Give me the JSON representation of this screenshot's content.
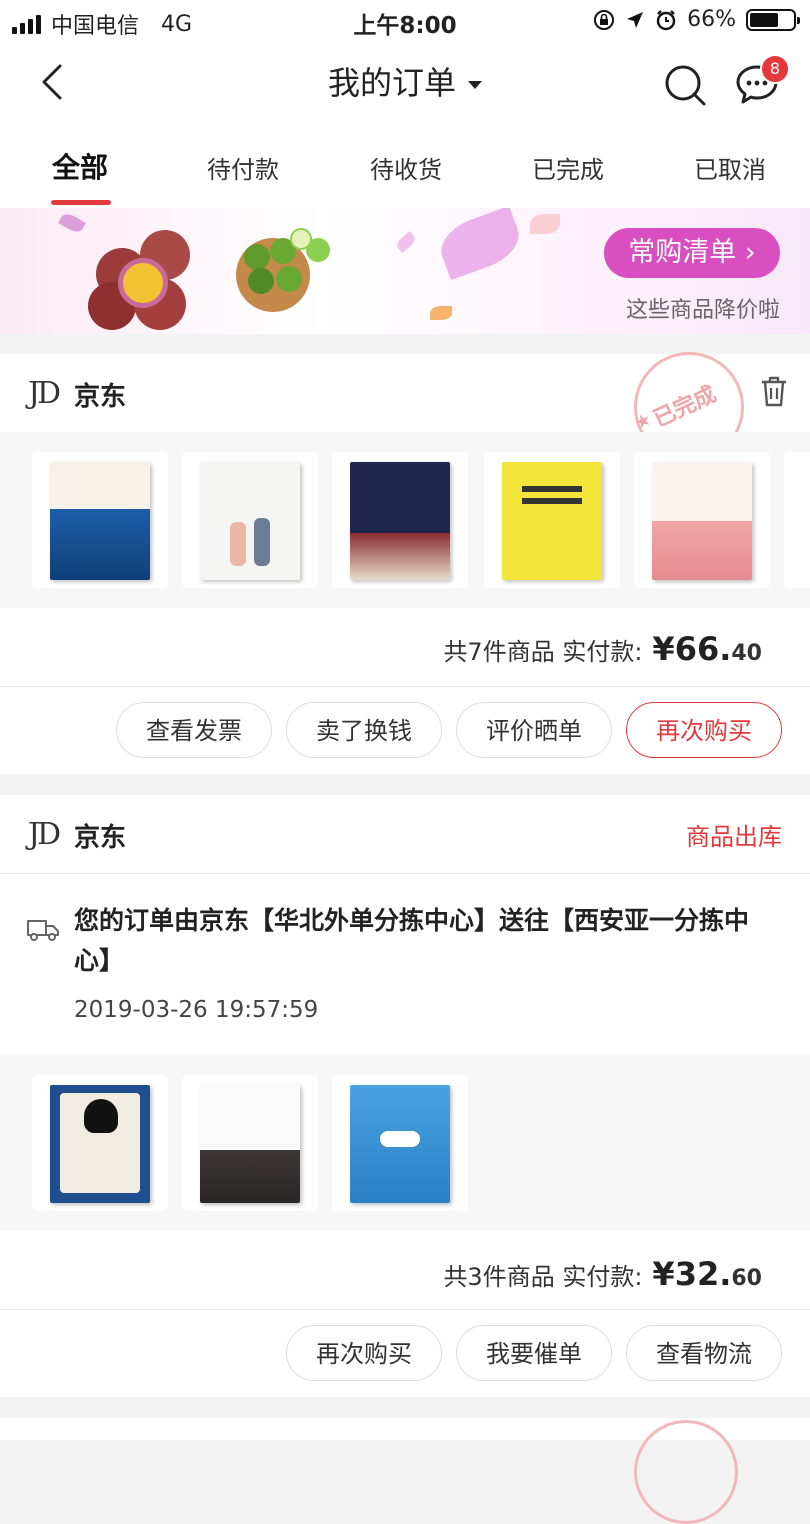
{
  "status_bar": {
    "carrier": "中国电信",
    "network": "4G",
    "time": "上午8:00",
    "battery": "66%",
    "battery_level": 0.66
  },
  "nav": {
    "title": "我的订单",
    "message_badge": "8"
  },
  "tabs": [
    {
      "label": "全部",
      "active": true
    },
    {
      "label": "待付款"
    },
    {
      "label": "待收货"
    },
    {
      "label": "已完成"
    },
    {
      "label": "已取消"
    }
  ],
  "banner": {
    "button": "常购清单",
    "subtitle": "这些商品降价啦"
  },
  "orders": [
    {
      "store": "京东",
      "stamp": "已完成",
      "summary_label": "共7件商品  实付款:",
      "price_main": "¥66.",
      "price_cents": "40",
      "actions": [
        "查看发票",
        "卖了换钱",
        "评价晒单",
        "再次购买"
      ]
    },
    {
      "store": "京东",
      "status": "商品出库",
      "tracking": "您的订单由京东【华北外单分拣中心】送往【西安亚一分拣中心】",
      "tracking_time": "2019-03-26 19:57:59",
      "summary_label": "共3件商品  实付款:",
      "price_main": "¥32.",
      "price_cents": "60",
      "actions": [
        "再次购买",
        "我要催单",
        "查看物流"
      ]
    }
  ],
  "colors": {
    "accent_red": "#e4393c",
    "banner_pink": "#d94fc1"
  }
}
